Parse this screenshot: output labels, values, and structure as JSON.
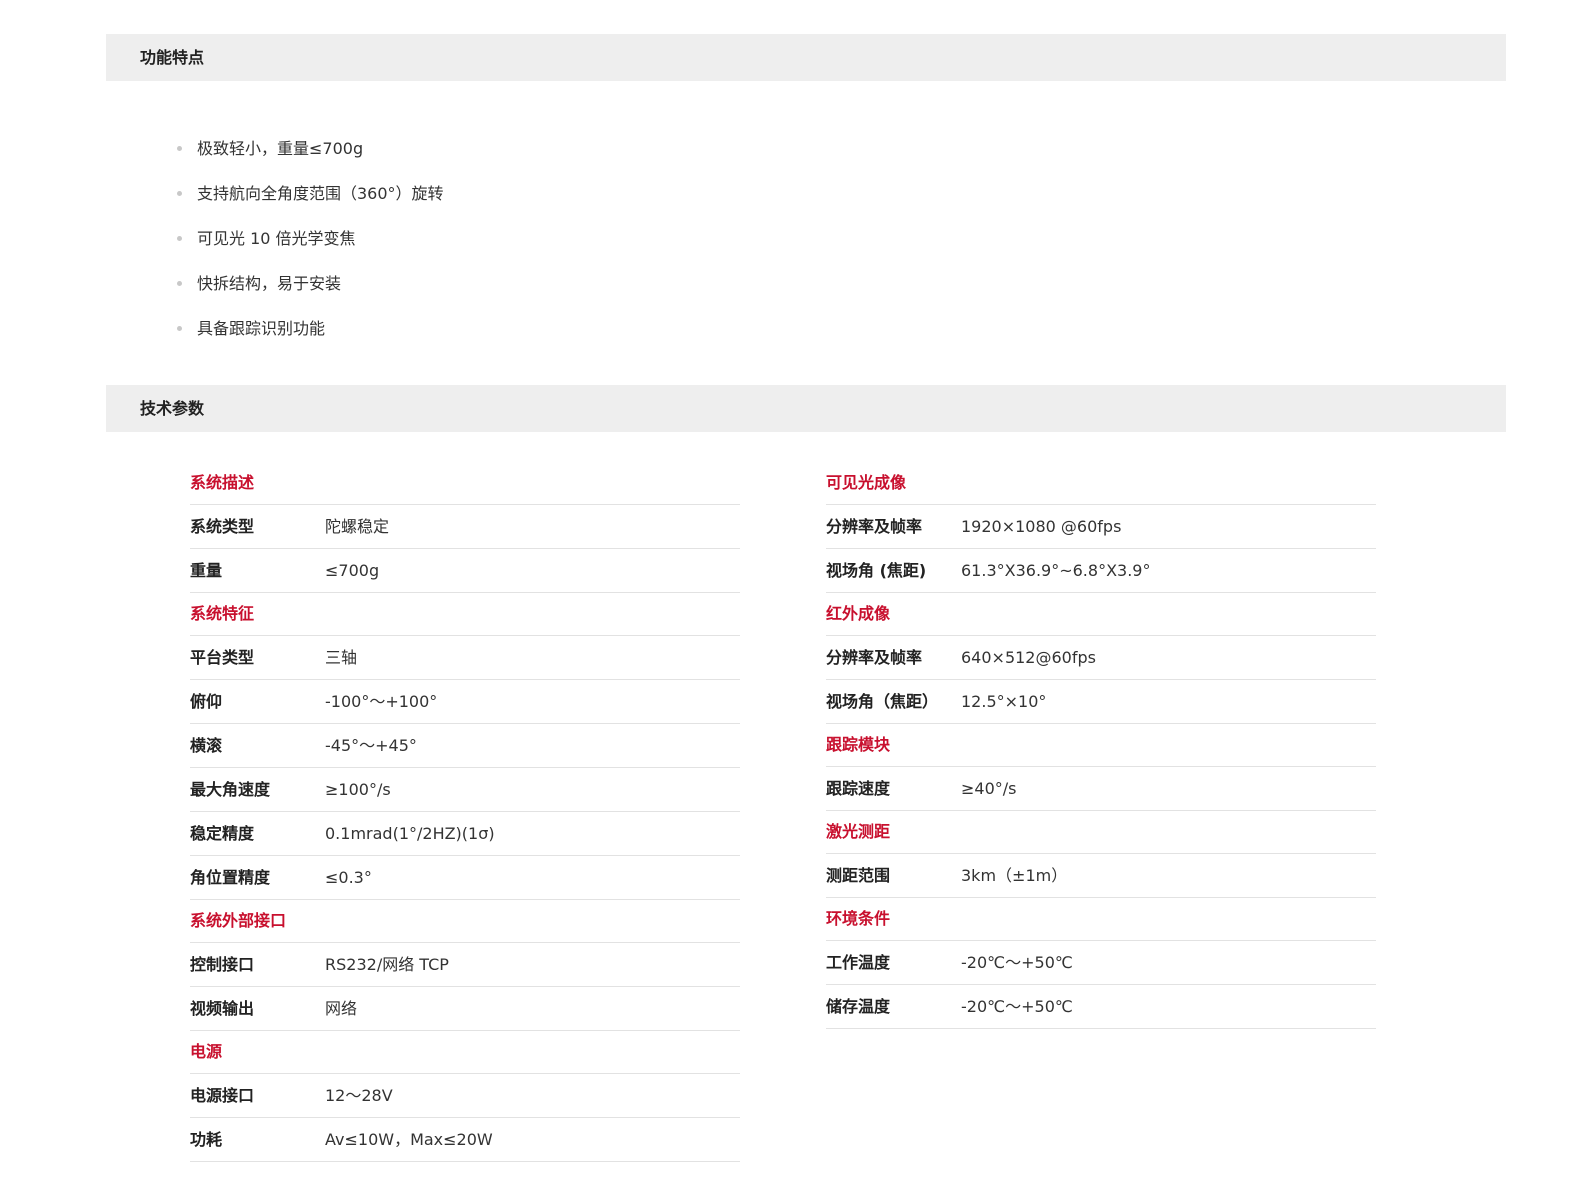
{
  "features_section": {
    "title": "功能特点",
    "items": [
      "极致轻小，重量≤700g",
      "支持航向全角度范围（360°）旋转",
      "可见光 10 倍光学变焦",
      "快拆结构，易于安装",
      "具备跟踪识别功能"
    ]
  },
  "specs_section": {
    "title": "技术参数",
    "left_groups": [
      {
        "title": "系统描述",
        "rows": [
          {
            "name": "系统类型",
            "value": "陀螺稳定"
          },
          {
            "name": "重量",
            "value": "≤700g"
          }
        ]
      },
      {
        "title": "系统特征",
        "rows": [
          {
            "name": "平台类型",
            "value": "三轴"
          },
          {
            "name": "俯仰",
            "value": "-100°～+100°"
          },
          {
            "name": "横滚",
            "value": "-45°～+45°"
          },
          {
            "name": "最大角速度",
            "value": "≥100°/s"
          },
          {
            "name": "稳定精度",
            "value": "0.1mrad(1°/2HZ)(1σ)"
          },
          {
            "name": "角位置精度",
            "value": "≤0.3°"
          }
        ]
      },
      {
        "title": "系统外部接口",
        "rows": [
          {
            "name": "控制接口",
            "value": "RS232/网络 TCP"
          },
          {
            "name": "视频输出",
            "value": "网络"
          }
        ]
      },
      {
        "title": "电源",
        "rows": [
          {
            "name": "电源接口",
            "value": "12～28V"
          },
          {
            "name": "功耗",
            "value": "Av≤10W，Max≤20W"
          }
        ]
      }
    ],
    "right_groups": [
      {
        "title": "可见光成像",
        "rows": [
          {
            "name": "分辨率及帧率",
            "value": "1920×1080 @60fps"
          },
          {
            "name": "视场角 (焦距)",
            "value": "61.3°X36.9°~6.8°X3.9°"
          }
        ]
      },
      {
        "title": "红外成像",
        "rows": [
          {
            "name": "分辨率及帧率",
            "value": "640×512@60fps"
          },
          {
            "name": "视场角（焦距）",
            "value": "12.5°×10°"
          }
        ]
      },
      {
        "title": "跟踪模块",
        "rows": [
          {
            "name": "跟踪速度",
            "value": "≥40°/s"
          }
        ]
      },
      {
        "title": "激光测距",
        "rows": [
          {
            "name": "测距范围",
            "value": "3km（±1m）"
          }
        ]
      },
      {
        "title": "环境条件",
        "rows": [
          {
            "name": "工作温度",
            "value": "-20℃～+50℃"
          },
          {
            "name": "储存温度",
            "value": "-20℃～+50℃"
          }
        ]
      }
    ]
  },
  "colors": {
    "accent": "#c8102e",
    "section_bar_bg": "#eeeeee",
    "divider": "#e2e2e2"
  }
}
